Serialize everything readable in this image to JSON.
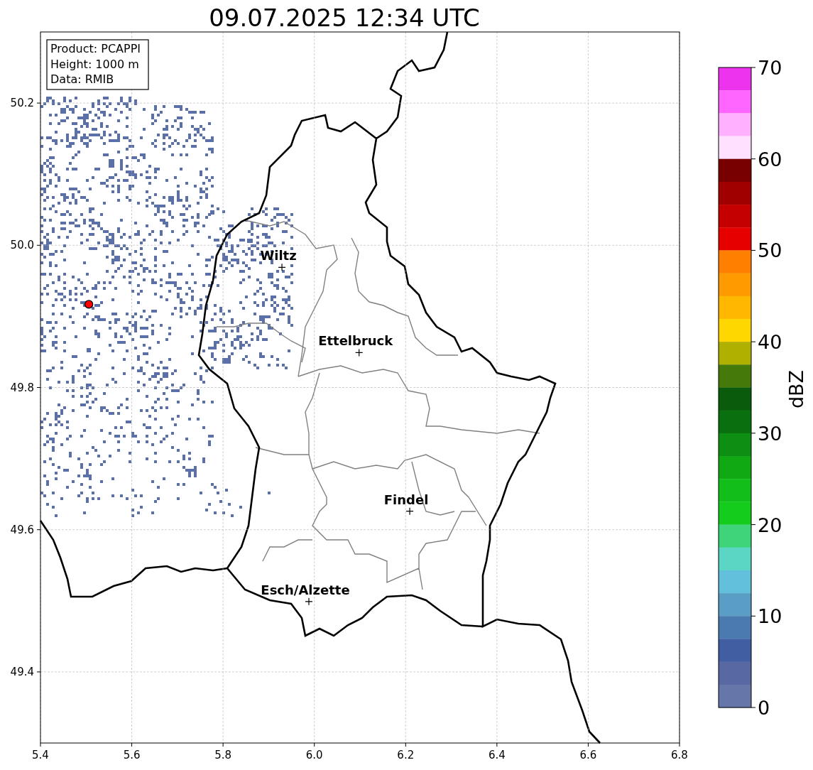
{
  "title": "09.07.2025 12:34 UTC",
  "info_box": {
    "lines": [
      "Product: PCAPPI",
      "Height: 1000 m",
      "Data: RMIB"
    ]
  },
  "map": {
    "chart_data": {
      "type": "scatter",
      "x": [
        5.929,
        6.098,
        6.209,
        5.988,
        5.506
      ],
      "series": [
        {
          "color": "#000000",
          "values": [
            49.969,
            49.849,
            49.626,
            49.499,
            null
          ]
        },
        {
          "color": "#ff0000",
          "values": [
            null,
            null,
            null,
            null,
            49.917
          ]
        }
      ],
      "grid": true,
      "xlim": [
        5.4,
        6.8
      ],
      "ylim": [
        49.3,
        50.3
      ],
      "xticks": [
        {
          "value": 5.4,
          "label": "5.4"
        },
        {
          "value": 5.6,
          "label": "5.6"
        },
        {
          "value": 5.8,
          "label": "5.8"
        },
        {
          "value": 6.0,
          "label": "6.0"
        },
        {
          "value": 6.2,
          "label": "6.2"
        },
        {
          "value": 6.4,
          "label": "6.4"
        },
        {
          "value": 6.6,
          "label": "6.6"
        },
        {
          "value": 6.8,
          "label": "6.8"
        }
      ],
      "yticks": [
        {
          "value": 49.4,
          "label": "49.4"
        },
        {
          "value": 49.6,
          "label": "49.6"
        },
        {
          "value": 49.8,
          "label": "49.8"
        },
        {
          "value": 50.0,
          "label": "50.0"
        },
        {
          "value": 50.2,
          "label": "50.2"
        }
      ],
      "annotations": [
        {
          "x": 5.929,
          "y": 49.969,
          "text": "Wiltz"
        },
        {
          "x": 6.098,
          "y": 49.849,
          "text": "Ettelbruck"
        },
        {
          "x": 6.209,
          "y": 49.626,
          "text": "Findel"
        },
        {
          "x": 5.988,
          "y": 49.499,
          "text": "Esch/Alzette"
        }
      ]
    }
  },
  "colorbar": {
    "label": "dBZ",
    "ticks": [
      "70",
      "60",
      "50",
      "40",
      "30",
      "20",
      "10",
      "0"
    ],
    "bins": [
      {
        "color": "#ee33ee"
      },
      {
        "color": "#ff66ff"
      },
      {
        "color": "#ffb0ff"
      },
      {
        "color": "#ffe0ff"
      },
      {
        "color": "#780000"
      },
      {
        "color": "#a00000"
      },
      {
        "color": "#c40000"
      },
      {
        "color": "#e60000"
      },
      {
        "color": "#ff7f00"
      },
      {
        "color": "#ff9a00"
      },
      {
        "color": "#ffb700"
      },
      {
        "color": "#ffd700"
      },
      {
        "color": "#afb000"
      },
      {
        "color": "#457a0a"
      },
      {
        "color": "#0a5c0c"
      },
      {
        "color": "#0a700f"
      },
      {
        "color": "#0e8e12"
      },
      {
        "color": "#10a813"
      },
      {
        "color": "#12be1a"
      },
      {
        "color": "#13cc1b"
      },
      {
        "color": "#3fd47a"
      },
      {
        "color": "#5cd6c4"
      },
      {
        "color": "#62c0dc"
      },
      {
        "color": "#5a9ec6"
      },
      {
        "color": "#4a7ab0"
      },
      {
        "color": "#425ea2"
      },
      {
        "color": "#5868a2"
      },
      {
        "color": "#6676a8"
      }
    ]
  }
}
